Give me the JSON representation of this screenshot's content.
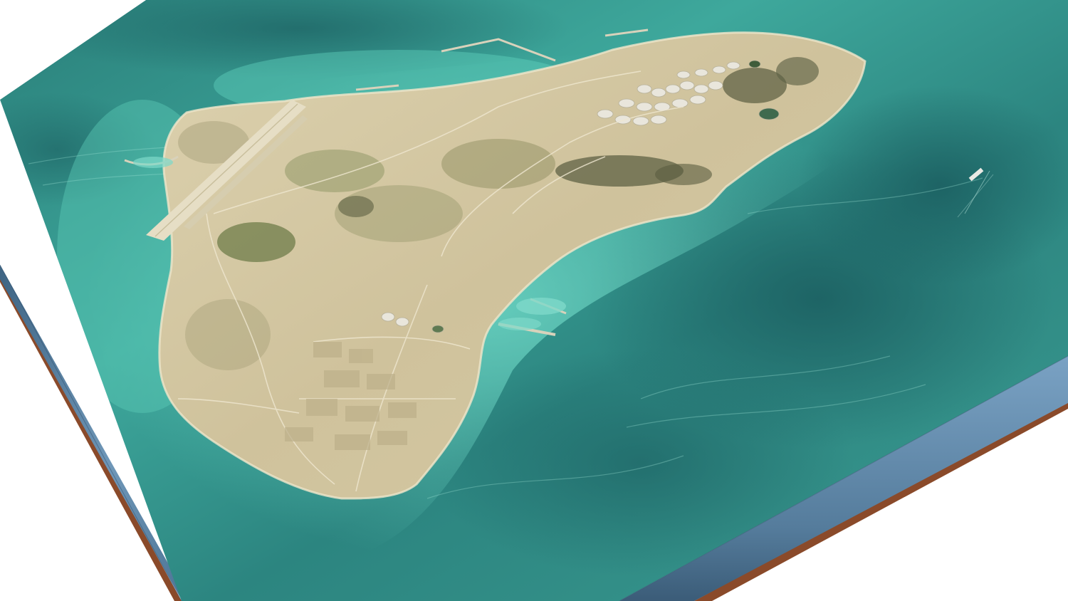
{
  "scene": {
    "kind": "3D terrain block render of an island (aerial imagery draped on relief)",
    "background_color": "#ffffff",
    "colors": {
      "deep_water": "#1f6a6a",
      "mid_water": "#2f8f86",
      "shallow_water": "#4fc1b0",
      "lagoon_turquoise": "#6fd6c4",
      "land_sand": "#d8cca8",
      "land_dark": "#b9a980",
      "vegetation": "#7d8a55",
      "hills": "#6b6a48",
      "runway": "#e4dcc4",
      "block_side_blue": "#5f86a8",
      "block_side_edge": "#2f4f6e",
      "block_base_brown": "#8a4a2a"
    },
    "features": [
      "island-landmass",
      "airport-runway",
      "oil-storage-tank-farm",
      "northern-harbor-breakwater",
      "eastern-harbor-jetty",
      "southern-town",
      "central-hills",
      "offshore-ship"
    ]
  }
}
